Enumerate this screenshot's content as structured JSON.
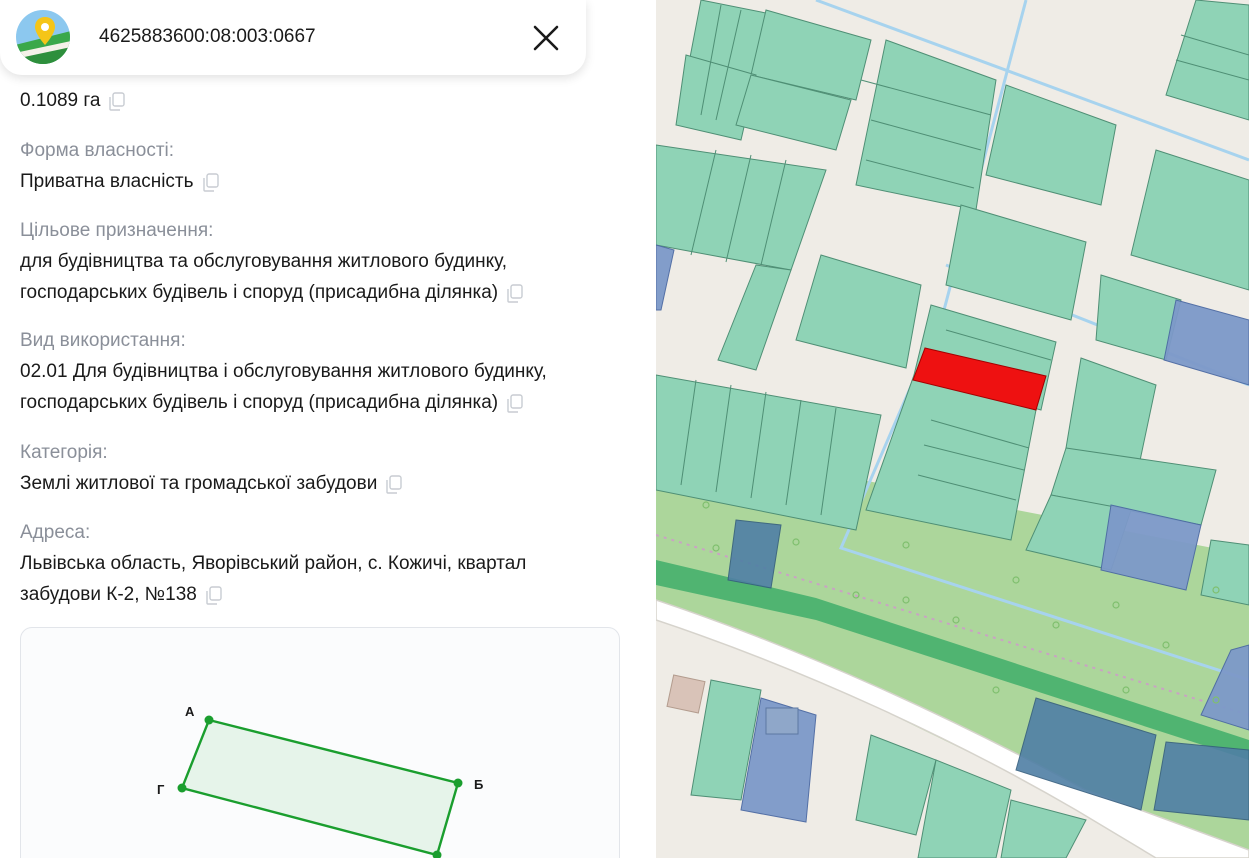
{
  "header": {
    "parcel_id": "4625883600:08:003:0667",
    "logo_icon": "map-pin-logo-icon",
    "close_icon": "close-icon"
  },
  "fields": [
    {
      "label": "",
      "value": "0.1089 га"
    },
    {
      "label": "Форма власності:",
      "value": "Приватна власність"
    },
    {
      "label": "Цільове призначення:",
      "value_lines": [
        "для будівництва та обслуговування житлового будинку,",
        "господарських будівель і споруд (присадибна ділянка)"
      ]
    },
    {
      "label": "Вид використання:",
      "value_lines": [
        "02.01 Для будівництва і обслуговування житлового будинку,",
        "господарських будівель і споруд (присадибна ділянка)"
      ]
    },
    {
      "label": "Категорія:",
      "value": "Землі житлової та громадської забудови"
    },
    {
      "label": "Адреса:",
      "value_lines": [
        "Львівська область, Яворівський район, с. Кожичі, квартал",
        "забудови К-2, №138"
      ]
    }
  ],
  "scheme": {
    "points": [
      "А",
      "Б",
      "Г"
    ],
    "line_color": "#1a9e2e"
  },
  "colors": {
    "label": "#8a8f99",
    "parcel_selected": "#ee1111",
    "parcel": "#8fd3b6",
    "parcel_blue": "#7d99c9",
    "map_bg": "#efece6",
    "green_zone": "#9fd08a"
  },
  "icons": {
    "copy": "copy-icon"
  }
}
